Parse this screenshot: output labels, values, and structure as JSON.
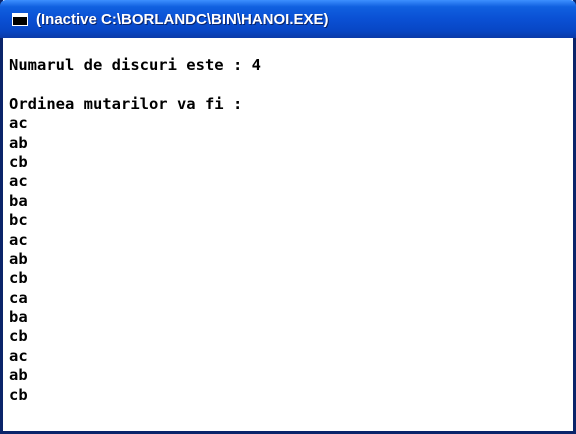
{
  "window": {
    "title": "(Inactive C:\\BORLANDC\\BIN\\HANOI.EXE)",
    "icon": "console-window-icon",
    "titlebar_color": "#0a50d4"
  },
  "console": {
    "disk_count_line": "Numarul de discuri este : 4",
    "moves_header": "Ordinea mutarilor va fi :",
    "moves": [
      "ac",
      "ab",
      "cb",
      "ac",
      "ba",
      "bc",
      "ac",
      "ab",
      "cb",
      "ca",
      "ba",
      "cb",
      "ac",
      "ab",
      "cb"
    ]
  }
}
